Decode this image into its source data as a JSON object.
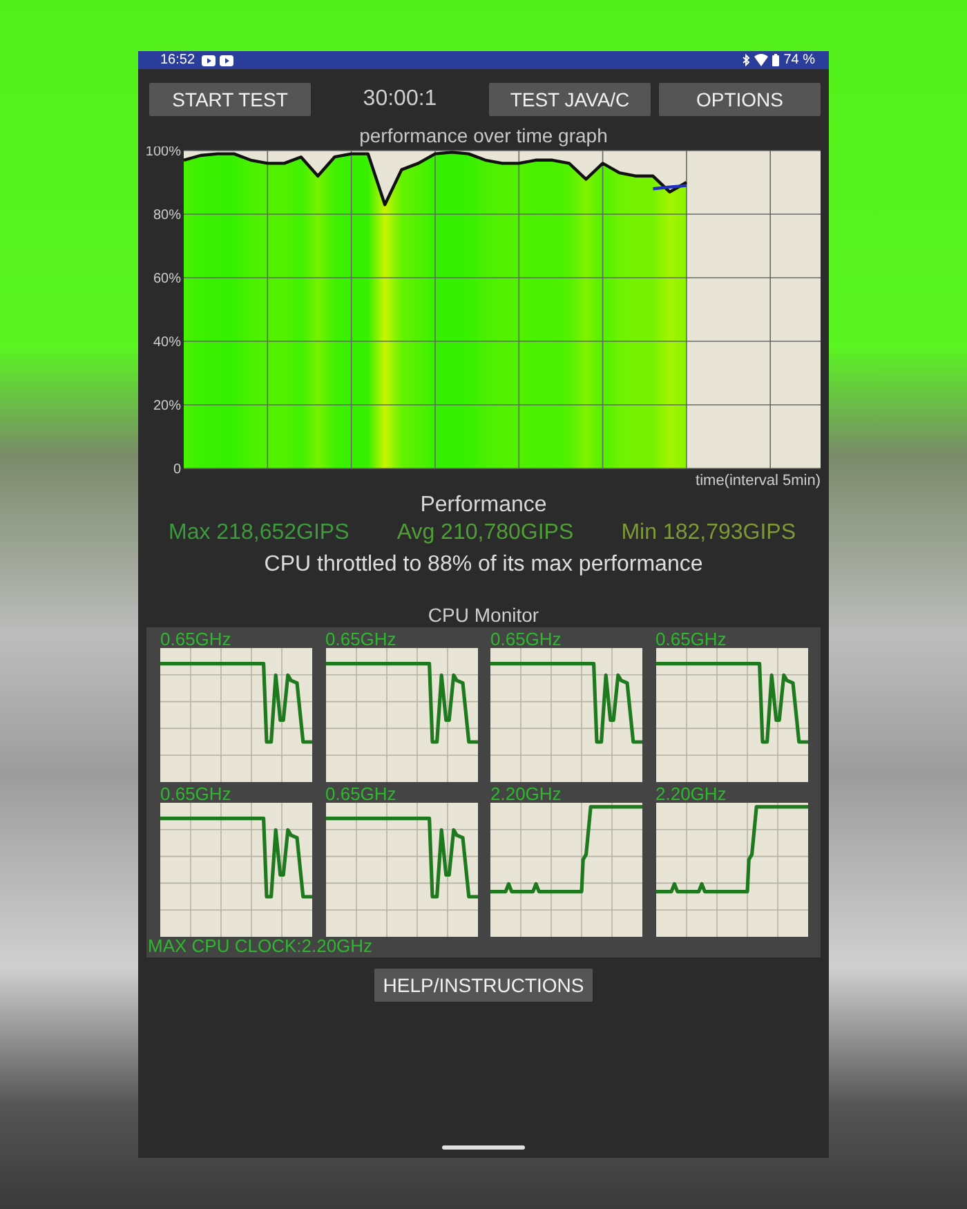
{
  "status_bar": {
    "time": "16:52",
    "battery": "74 %"
  },
  "toolbar": {
    "start_button": "START TEST",
    "timer": "30:00:1",
    "mode_button": "TEST JAVA/C",
    "options_button": "OPTIONS"
  },
  "graph": {
    "chart_data": {
      "type": "line",
      "grid": true,
      "title": "performance over time graph",
      "xlabel": "time(interval 5min)",
      "categories": [
        null,
        null,
        null,
        null,
        null,
        null,
        null,
        null,
        null,
        null,
        null,
        null,
        null,
        null,
        null,
        null,
        null,
        null,
        null,
        null,
        null,
        null,
        null,
        null,
        null,
        null,
        null,
        null,
        null,
        null,
        null,
        null,
        null,
        null,
        null,
        null,
        null,
        null,
        null
      ],
      "ylim": [
        0,
        100
      ],
      "yticks": [
        {
          "value": 0,
          "label": "0"
        },
        {
          "value": 20,
          "label": "20%"
        },
        {
          "value": 40,
          "label": "40%"
        },
        {
          "value": 60,
          "label": "60%"
        },
        {
          "value": 80,
          "label": "80%"
        },
        {
          "value": 100,
          "label": "100%"
        }
      ],
      "series": [
        {
          "color": "#111111",
          "values": [
            97,
            98.5,
            99,
            99,
            97,
            96,
            96,
            98,
            92,
            98,
            99,
            99,
            83,
            94,
            96,
            99,
            99.5,
            99,
            97,
            96,
            96,
            97,
            97,
            96,
            91,
            96,
            93,
            92,
            92,
            87,
            90,
            null,
            null,
            null,
            null,
            null,
            null,
            null,
            null
          ]
        },
        {
          "color": "#2030c0",
          "values": [
            null,
            null,
            null,
            null,
            null,
            null,
            null,
            null,
            null,
            null,
            null,
            null,
            null,
            null,
            null,
            null,
            null,
            null,
            null,
            null,
            null,
            null,
            null,
            null,
            null,
            null,
            null,
            null,
            88,
            88.5,
            89,
            null,
            null,
            null,
            null,
            null,
            null,
            null,
            null
          ]
        }
      ]
    }
  },
  "performance": {
    "heading": "Performance",
    "stats": [
      {
        "text": "Max 218,652GIPS",
        "color": "#3c9c3c"
      },
      {
        "text": "Avg 210,780GIPS",
        "color": "#4f9e36"
      },
      {
        "text": "Min 182,793GIPS",
        "color": "#7e9a34"
      }
    ],
    "summary": "CPU throttled to 88% of its max performance"
  },
  "cpu_monitor": {
    "title": "CPU Monitor",
    "cores": [
      {
        "frequency": "0.65GHz",
        "kind": "drop"
      },
      {
        "frequency": "0.65GHz",
        "kind": "drop"
      },
      {
        "frequency": "0.65GHz",
        "kind": "drop"
      },
      {
        "frequency": "0.65GHz",
        "kind": "drop"
      },
      {
        "frequency": "0.65GHz",
        "kind": "drop"
      },
      {
        "frequency": "0.65GHz",
        "kind": "drop"
      },
      {
        "frequency": "2.20GHz",
        "kind": "rise"
      },
      {
        "frequency": "2.20GHz",
        "kind": "rise"
      }
    ],
    "max_clock": "MAX CPU CLOCK:2.20GHz"
  },
  "help_button": "HELP/INSTRUCTIONS"
}
